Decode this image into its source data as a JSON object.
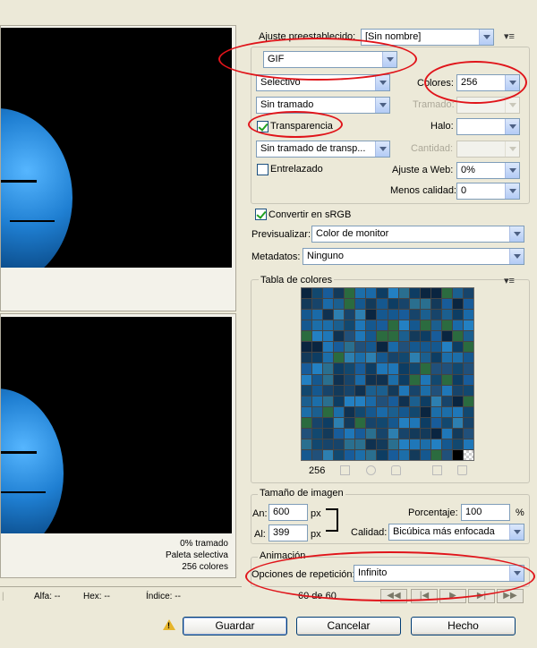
{
  "preset": {
    "label": "Ajuste preestablecido:",
    "value": "[Sin nombre]",
    "menu_icon": "panel-menu-icon"
  },
  "format": {
    "value": "GIF"
  },
  "reduction": {
    "value": "Selectivo"
  },
  "colors": {
    "label": "Colores:",
    "value": "256"
  },
  "dither": {
    "value": "Sin tramado"
  },
  "dither_amount": {
    "label": "Tramado:",
    "value": ""
  },
  "transparency": {
    "label": "Transparencia",
    "checked": true
  },
  "matte": {
    "label": "Halo:",
    "value": ""
  },
  "transparency_dither": {
    "value": "Sin tramado de transp...",
    "amount_label": "Cantidad:",
    "amount_value": ""
  },
  "interlaced": {
    "label": "Entrelazado",
    "checked": false
  },
  "web_snap": {
    "label": "Ajuste a Web:",
    "value": "0%"
  },
  "lossy": {
    "label": "Menos calidad:",
    "value": "0"
  },
  "convert_srgb": {
    "label": "Convertir en sRGB",
    "checked": true
  },
  "preview": {
    "label": "Previsualizar:",
    "value": "Color de monitor"
  },
  "metadata": {
    "label": "Metadatos:",
    "value": "Ninguno"
  },
  "color_table": {
    "title": "Tabla de colores",
    "count": "256",
    "menu_icon": "panel-menu-icon"
  },
  "image_size": {
    "title": "Tamaño de imagen",
    "width_label": "An:",
    "width_value": "600",
    "height_label": "Al:",
    "height_value": "399",
    "unit": "px",
    "percent_label": "Porcentaje:",
    "percent_value": "100",
    "percent_unit": "%",
    "quality_label": "Calidad:",
    "quality_value": "Bicúbica más enfocada"
  },
  "animation": {
    "title": "Animación",
    "loop_label": "Opciones de repetición:",
    "loop_value": "Infinito",
    "frame_counter": "60 de 60"
  },
  "preview_info": {
    "line1": "0% tramado",
    "line2": "Paleta selectiva",
    "line3": "256 colores"
  },
  "status": {
    "alpha": "Alfa: --",
    "hex": "Hex: --",
    "index": "Índice: --"
  },
  "buttons": {
    "save": "Guardar",
    "cancel": "Cancelar",
    "done": "Hecho"
  },
  "colors_palette": {
    "accent_oval": "#e0141a",
    "globe": "#1f7fd2"
  }
}
